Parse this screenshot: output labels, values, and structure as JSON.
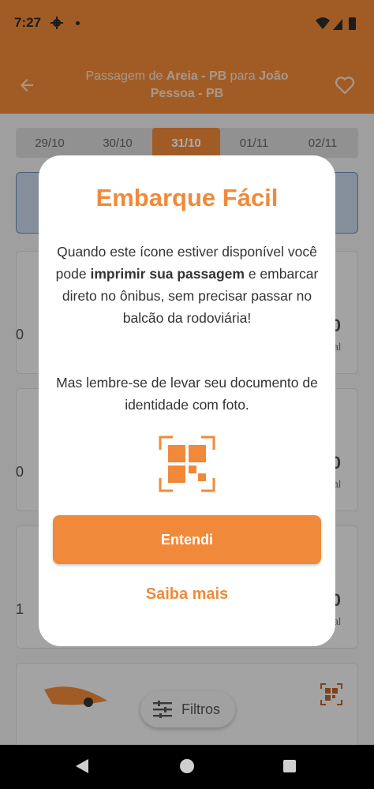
{
  "status_bar": {
    "time": "7:27"
  },
  "header": {
    "title_prefix": "Passagem de ",
    "origin": "Areia - PB",
    "title_mid": " para ",
    "destination": "João Pessoa - PB"
  },
  "dates": [
    {
      "label": "29/10",
      "active": false
    },
    {
      "label": "30/10",
      "active": false
    },
    {
      "label": "31/10",
      "active": true
    },
    {
      "label": "01/11",
      "active": false
    },
    {
      "label": "02/11",
      "active": false
    }
  ],
  "trips": [
    {
      "left": "0",
      "right": "0",
      "sub": "al"
    },
    {
      "left": "0",
      "right": "0",
      "sub": "al"
    },
    {
      "left": "1",
      "right": "0",
      "sub": "al"
    }
  ],
  "filters": {
    "label": "Filtros"
  },
  "modal": {
    "title": "Embarque Fácil",
    "text_part1": "Quando este ícone estiver disponível você pode ",
    "text_bold": "imprimir sua passagem",
    "text_part2": " e embarcar direto no ônibus, sem precisar passar no balcão da rodoviária!",
    "text2": "Mas lembre-se de levar seu documento de identidade com foto.",
    "primary_button": "Entendi",
    "link_button": "Saiba mais"
  },
  "colors": {
    "accent": "#f08a3a"
  },
  "icons": [
    "gear-icon",
    "wifi-icon",
    "signal-icon",
    "battery-icon",
    "back-arrow-icon",
    "heart-icon",
    "qr-code-icon",
    "filters-icon",
    "nav-back-icon",
    "nav-home-icon",
    "nav-recents-icon"
  ]
}
